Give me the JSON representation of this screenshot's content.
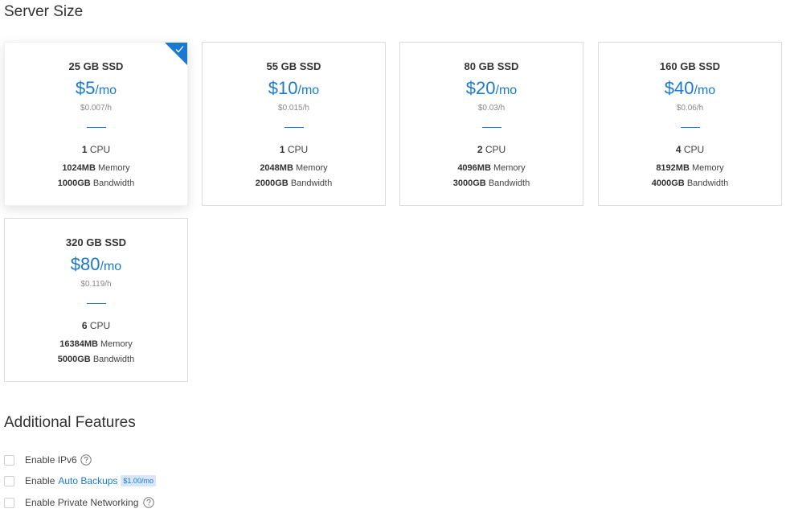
{
  "server_size": {
    "title": "Server Size",
    "plans": [
      {
        "ssd": "25 GB SSD",
        "price": "$5",
        "unit": "/mo",
        "hourly": "$0.007/h",
        "cpu_count": "1",
        "cpu_label": " CPU",
        "memory": "1024MB",
        "memory_label": " Memory",
        "bandwidth": "1000GB",
        "bandwidth_label": " Bandwidth",
        "selected": true
      },
      {
        "ssd": "55 GB SSD",
        "price": "$10",
        "unit": "/mo",
        "hourly": "$0.015/h",
        "cpu_count": "1",
        "cpu_label": " CPU",
        "memory": "2048MB",
        "memory_label": " Memory",
        "bandwidth": "2000GB",
        "bandwidth_label": " Bandwidth",
        "selected": false
      },
      {
        "ssd": "80 GB SSD",
        "price": "$20",
        "unit": "/mo",
        "hourly": "$0.03/h",
        "cpu_count": "2",
        "cpu_label": " CPU",
        "memory": "4096MB",
        "memory_label": " Memory",
        "bandwidth": "3000GB",
        "bandwidth_label": " Bandwidth",
        "selected": false
      },
      {
        "ssd": "160 GB SSD",
        "price": "$40",
        "unit": "/mo",
        "hourly": "$0.06/h",
        "cpu_count": "4",
        "cpu_label": " CPU",
        "memory": "8192MB",
        "memory_label": " Memory",
        "bandwidth": "4000GB",
        "bandwidth_label": " Bandwidth",
        "selected": false
      },
      {
        "ssd": "320 GB SSD",
        "price": "$80",
        "unit": "/mo",
        "hourly": "$0.119/h",
        "cpu_count": "6",
        "cpu_label": " CPU",
        "memory": "16384MB",
        "memory_label": " Memory",
        "bandwidth": "5000GB",
        "bandwidth_label": " Bandwidth",
        "selected": false
      }
    ]
  },
  "additional_features": {
    "title": "Additional Features",
    "ipv6": {
      "label": "Enable IPv6",
      "checked": false,
      "help_icon": "question-circle-icon"
    },
    "backups": {
      "label": "Enable",
      "link": "Auto Backups",
      "price": "$1.00/mo",
      "checked": false
    },
    "private_networking": {
      "label": "Enable Private Networking",
      "checked": false,
      "help_icon": "question-circle-icon"
    }
  },
  "colors": {
    "accent": "#1a7ad3",
    "badge_bg": "#d8e6f5"
  }
}
